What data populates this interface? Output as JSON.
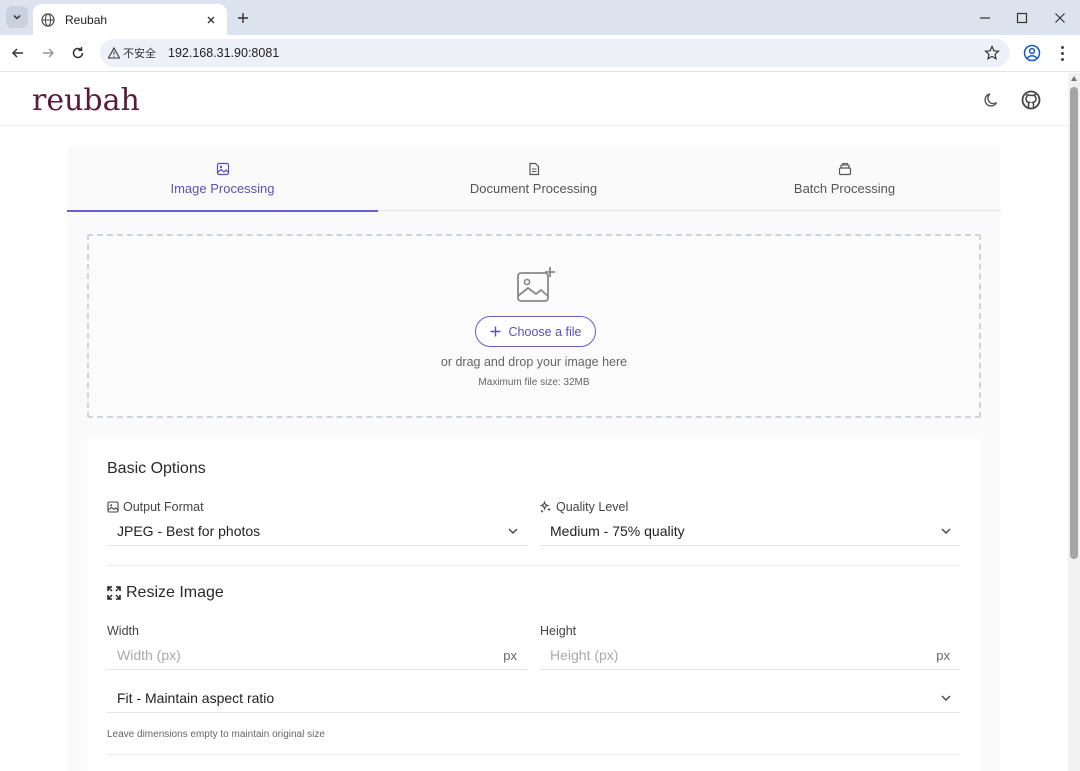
{
  "browser": {
    "tab_title": "Reubah",
    "insecure_label": "不安全",
    "url": "192.168.31.90:8081"
  },
  "site": {
    "logo_text": "reubah"
  },
  "tabs": [
    {
      "label": "Image Processing",
      "icon": "image-icon",
      "active": true
    },
    {
      "label": "Document Processing",
      "icon": "document-icon",
      "active": false
    },
    {
      "label": "Batch Processing",
      "icon": "stack-icon",
      "active": false
    }
  ],
  "dropzone": {
    "button_label": "Choose a file",
    "text": "or drag and drop your image here",
    "max_size": "Maximum file size: 32MB"
  },
  "basic_options": {
    "title": "Basic Options",
    "output_format_label": "Output Format",
    "output_format_value": "JPEG - Best for photos",
    "quality_label": "Quality Level",
    "quality_value": "Medium - 75% quality"
  },
  "resize": {
    "title": "Resize Image",
    "width_label": "Width",
    "width_placeholder": "Width (px)",
    "height_label": "Height",
    "height_placeholder": "Height (px)",
    "unit": "px",
    "fit_value": "Fit - Maintain aspect ratio",
    "hint": "Leave dimensions empty to maintain original size"
  },
  "colors": {
    "accent": "#6a5fc8",
    "logo": "#5a1c3a"
  }
}
